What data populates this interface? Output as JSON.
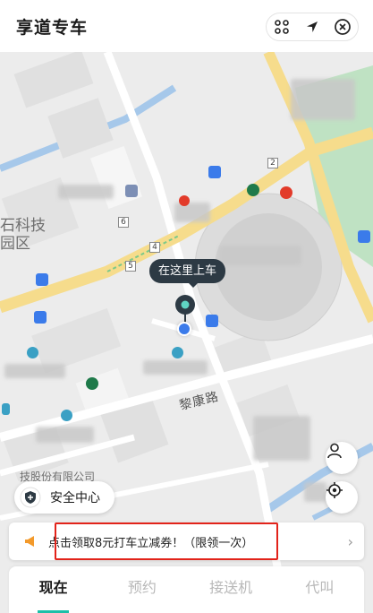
{
  "header": {
    "title": "享道专车"
  },
  "map": {
    "area_label_line1": "石科技",
    "area_label_line2": "园区",
    "company_label": "技股份有限公司",
    "road_label": "黎康路",
    "route_badges": [
      "2",
      "6",
      "4",
      "5"
    ],
    "pickup_tip": "在这里上车"
  },
  "safety": {
    "label": "安全中心"
  },
  "promo": {
    "text": "点击领取8元打车立减券！（限领一次）"
  },
  "tabs": [
    {
      "label": "现在",
      "active": true
    },
    {
      "label": "预约",
      "active": false
    },
    {
      "label": "接送机",
      "active": false
    },
    {
      "label": "代叫",
      "active": false
    }
  ],
  "colors": {
    "accent": "#1dbfa8",
    "pin": "#2d3a44",
    "highlight_border": "#e2231a",
    "main_road": "#f6dc8c",
    "water": "#a6c8ea",
    "green": "#7bc98a"
  }
}
